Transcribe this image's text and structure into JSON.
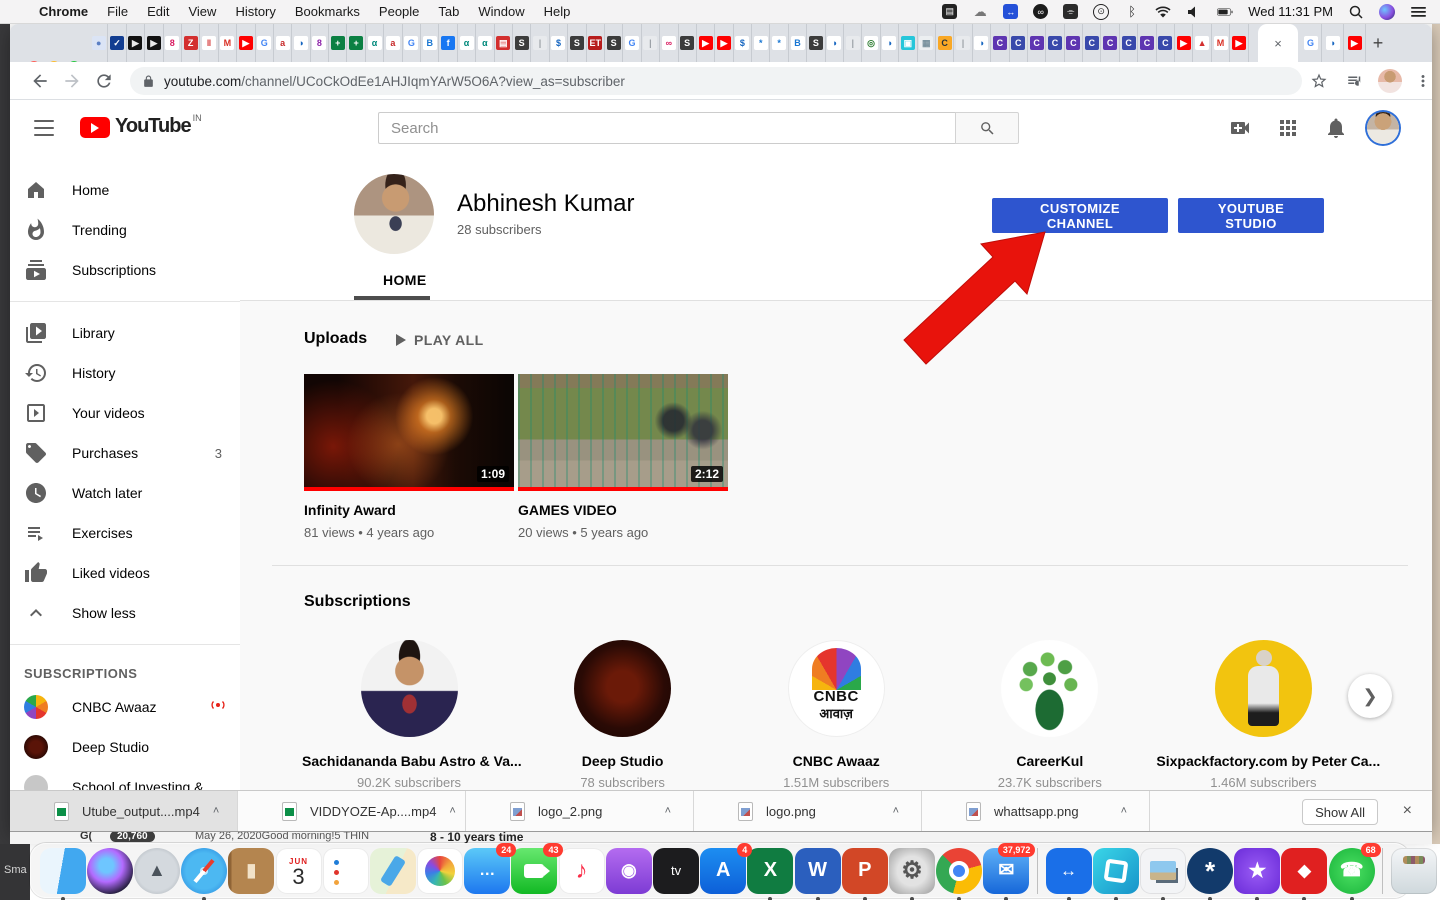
{
  "colors": {
    "accent_blue": "#2e55cf",
    "yt_red": "#ff0000",
    "live_red": "#e62117",
    "arrow_red": "#e8130c"
  },
  "menubar": {
    "app_name": "Chrome",
    "menus": [
      "File",
      "Edit",
      "View",
      "History",
      "Bookmarks",
      "People",
      "Tab",
      "Window",
      "Help"
    ],
    "clock": "Wed 11:31 PM",
    "status_icons": [
      "notes-icon",
      "cloud-sync-icon",
      "teamviewer-icon",
      "creative-cloud-icon",
      "sidecar-icon",
      "accessibility-icon",
      "bluetooth-icon",
      "wifi-icon",
      "volume-icon",
      "battery-icon"
    ]
  },
  "browser": {
    "url_host": "youtube.com",
    "url_path": "/channel/UCoCkOdEe1AHJIqmYArW5O6A?view_as=subscriber",
    "active_tab_close": "×",
    "new_tab_label": "+",
    "tabs": [
      [
        "●",
        "#dbe4f5",
        "#5b7fc4"
      ],
      [
        "✓",
        "#123d91",
        "#ffffff"
      ],
      [
        "▶",
        "#111111",
        "#e8e8e8"
      ],
      [
        "▶",
        "#111111",
        "#e8e8e8"
      ],
      [
        "8",
        "#ffffff",
        "#d81b60"
      ],
      [
        "Z",
        "#d32f2f",
        "#ffffff"
      ],
      [
        "‖",
        "#ffffff",
        "#d32f2f"
      ],
      [
        "M",
        "#ffffff",
        "#d93025"
      ],
      [
        "▶",
        "#ff0000",
        "#ffffff"
      ],
      [
        "G",
        "#ffffff",
        "#4285f4"
      ],
      [
        "a",
        "#ffffff",
        "#c62828"
      ],
      [
        "◑",
        "#ffffff",
        "#1565c0"
      ],
      [
        "8",
        "#ffffff",
        "#8e24aa"
      ],
      [
        "+",
        "#0b8043",
        "#ffffff"
      ],
      [
        "+",
        "#0b8043",
        "#ffffff"
      ],
      [
        "α",
        "#ffffff",
        "#00897b"
      ],
      [
        "a",
        "#ffffff",
        "#c62828"
      ],
      [
        "G",
        "#ffffff",
        "#4285f4"
      ],
      [
        "B",
        "#ffffff",
        "#1976d2"
      ],
      [
        "f",
        "#1877f2",
        "#ffffff"
      ],
      [
        "α",
        "#ffffff",
        "#00897b"
      ],
      [
        "α",
        "#ffffff",
        "#00897b"
      ],
      [
        "▤",
        "#d32f2f",
        "#ffffff"
      ],
      [
        "S",
        "#3c3c3c",
        "#ffffff"
      ],
      [
        "|",
        "#e8eaed",
        "#9aa0a6"
      ],
      [
        "$",
        "#ffffff",
        "#1565c0"
      ],
      [
        "S",
        "#3c3c3c",
        "#ffffff"
      ],
      [
        "ET",
        "#b71c1c",
        "#ffffff"
      ],
      [
        "S",
        "#3c3c3c",
        "#ffffff"
      ],
      [
        "G",
        "#ffffff",
        "#4285f4"
      ],
      [
        "|",
        "#e8eaed",
        "#9aa0a6"
      ],
      [
        "∞",
        "#ffffff",
        "#d81b60"
      ],
      [
        "S",
        "#3c3c3c",
        "#ffffff"
      ],
      [
        "▶",
        "#ff0000",
        "#ffffff"
      ],
      [
        "▶",
        "#ff0000",
        "#ffffff"
      ],
      [
        "$",
        "#ffffff",
        "#1565c0"
      ],
      [
        "*",
        "#ffffff",
        "#1976d2"
      ],
      [
        "*",
        "#ffffff",
        "#1976d2"
      ],
      [
        "B",
        "#ffffff",
        "#1976d2"
      ],
      [
        "S",
        "#3c3c3c",
        "#ffffff"
      ],
      [
        "◑",
        "#ffffff",
        "#1565c0"
      ],
      [
        "|",
        "#e8eaed",
        "#9aa0a6"
      ],
      [
        "◎",
        "#ffffff",
        "#2e7d32"
      ],
      [
        "◑",
        "#ffffff",
        "#1565c0"
      ],
      [
        "▣",
        "#26c6da",
        "#ffffff"
      ],
      [
        "▦",
        "#eceff1",
        "#78909c"
      ],
      [
        "C",
        "#f9a825",
        "#263238"
      ],
      [
        "|",
        "#e8eaed",
        "#9aa0a6"
      ],
      [
        "◑",
        "#ffffff",
        "#1565c0"
      ],
      [
        "C",
        "#5e35b1",
        "#ffffff"
      ],
      [
        "C",
        "#3949ab",
        "#ffffff"
      ],
      [
        "C",
        "#5e35b1",
        "#ffffff"
      ],
      [
        "C",
        "#3949ab",
        "#ffffff"
      ],
      [
        "C",
        "#5e35b1",
        "#ffffff"
      ],
      [
        "C",
        "#3949ab",
        "#ffffff"
      ],
      [
        "C",
        "#5e35b1",
        "#ffffff"
      ],
      [
        "C",
        "#3949ab",
        "#ffffff"
      ],
      [
        "C",
        "#5e35b1",
        "#ffffff"
      ],
      [
        "C",
        "#3949ab",
        "#ffffff"
      ],
      [
        "▶",
        "#ff0000",
        "#ffffff"
      ],
      [
        "▲",
        "#ffffff",
        "#d32f2f"
      ],
      [
        "M",
        "#ffffff",
        "#d93025"
      ],
      [
        "▶",
        "#ff0000",
        "#ffffff"
      ]
    ],
    "after_tabs": [
      [
        "G",
        "#ffffff",
        "#4285f4"
      ],
      [
        "◑",
        "#ffffff",
        "#1565c0"
      ],
      [
        "▶",
        "#ff0000",
        "#ffffff"
      ]
    ]
  },
  "youtube": {
    "logo_text": "YouTube",
    "logo_country": "IN",
    "search_placeholder": "Search"
  },
  "sidebar": {
    "main": [
      {
        "icon": "home",
        "label": "Home"
      },
      {
        "icon": "trending",
        "label": "Trending"
      },
      {
        "icon": "subscriptions",
        "label": "Subscriptions"
      }
    ],
    "secondary": [
      {
        "icon": "library",
        "label": "Library"
      },
      {
        "icon": "history",
        "label": "History"
      },
      {
        "icon": "your-videos",
        "label": "Your videos"
      },
      {
        "icon": "purchases",
        "label": "Purchases",
        "badge": "3"
      },
      {
        "icon": "watch-later",
        "label": "Watch later"
      },
      {
        "icon": "exercises",
        "label": "Exercises"
      },
      {
        "icon": "liked",
        "label": "Liked videos"
      },
      {
        "icon": "show-less",
        "label": "Show less"
      }
    ],
    "subs_header": "SUBSCRIPTIONS",
    "subs": [
      {
        "label": "CNBC Awaaz",
        "avatar": "cnbc",
        "live": true
      },
      {
        "label": "Deep Studio",
        "avatar": "deep"
      },
      {
        "label": "School of Investing &",
        "avatar": "school"
      }
    ]
  },
  "channel": {
    "name": "Abhinesh Kumar",
    "subscribers": "28 subscribers",
    "customize_label": "CUSTOMIZE CHANNEL",
    "studio_label": "YOUTUBE STUDIO",
    "tab_home": "HOME"
  },
  "sections": {
    "uploads_title": "Uploads",
    "play_all": "PLAY ALL",
    "subscriptions_title": "Subscriptions"
  },
  "videos": [
    {
      "title": "Infinity Award",
      "duration": "1:09",
      "meta": "81 views • 4 years ago",
      "thumb": "infinity"
    },
    {
      "title": "GAMES VIDEO",
      "duration": "2:12",
      "meta": "20 views • 5 years ago",
      "thumb": "games"
    }
  ],
  "shelf": {
    "channels": [
      {
        "name": "Sachidananda Babu Astro & Va...",
        "subs": "90.2K subscribers",
        "avatar": "sach"
      },
      {
        "name": "Deep Studio",
        "subs": "78 subscribers",
        "avatar": "deep"
      },
      {
        "name": "CNBC Awaaz",
        "subs": "1.51M subscribers",
        "avatar": "cnbc",
        "cnbc_line1": "CNBC",
        "cnbc_line2": "आवाज़"
      },
      {
        "name": "CareerKul",
        "subs": "23.7K subscribers",
        "avatar": "career"
      },
      {
        "name": "Sixpackfactory.com by Peter Ca...",
        "subs": "1.46M subscribers",
        "avatar": "sixpack"
      }
    ]
  },
  "downloads": {
    "items": [
      {
        "label": "Utube_output....mp4",
        "type": "video"
      },
      {
        "label": "VIDDYOZE-Ap....mp4",
        "type": "video"
      },
      {
        "label": "logo_2.png",
        "type": "image"
      },
      {
        "label": "logo.png",
        "type": "image"
      },
      {
        "label": "whattsapp.png",
        "type": "image"
      }
    ],
    "show_all": "Show All",
    "close": "×"
  },
  "dock": {
    "calendar_month": "JUN",
    "calendar_day": "3",
    "apps": [
      {
        "id": "finder",
        "dot": true
      },
      {
        "id": "siri"
      },
      {
        "id": "launchpad"
      },
      {
        "id": "safari",
        "dot": true
      },
      {
        "id": "contacts"
      },
      {
        "id": "calendar"
      },
      {
        "id": "reminders"
      },
      {
        "id": "maps"
      },
      {
        "id": "photos"
      },
      {
        "id": "messages",
        "badge": "24"
      },
      {
        "id": "facetime",
        "badge": "43"
      },
      {
        "id": "music"
      },
      {
        "id": "podcasts"
      },
      {
        "id": "appletv"
      },
      {
        "id": "appstore",
        "badge": "4"
      },
      {
        "id": "excel",
        "dot": true
      },
      {
        "id": "word",
        "dot": true
      },
      {
        "id": "powerpoint",
        "dot": true
      },
      {
        "id": "sysprefs",
        "dot": true
      },
      {
        "id": "chrome",
        "dot": true
      },
      {
        "id": "mail",
        "badge": "37,972",
        "dot": true
      },
      {
        "divider": true
      },
      {
        "id": "teamviewer",
        "dot": true
      },
      {
        "id": "frames",
        "dot": true
      },
      {
        "id": "preview",
        "dot": true
      },
      {
        "id": "clover",
        "dot": true
      },
      {
        "id": "imovie",
        "dot": true
      },
      {
        "id": "reddiamond",
        "dot": true
      },
      {
        "id": "whatsapp",
        "badge": "68",
        "dot": true
      },
      {
        "divider": true
      },
      {
        "id": "trash"
      }
    ]
  },
  "fragments": {
    "gmail_letter": "G(",
    "gmail_badge": "20,760",
    "line_morning": "May 26, 2020Good morning!5 THIN",
    "line_years": "8 - 10 years time",
    "corner": "Sma"
  }
}
